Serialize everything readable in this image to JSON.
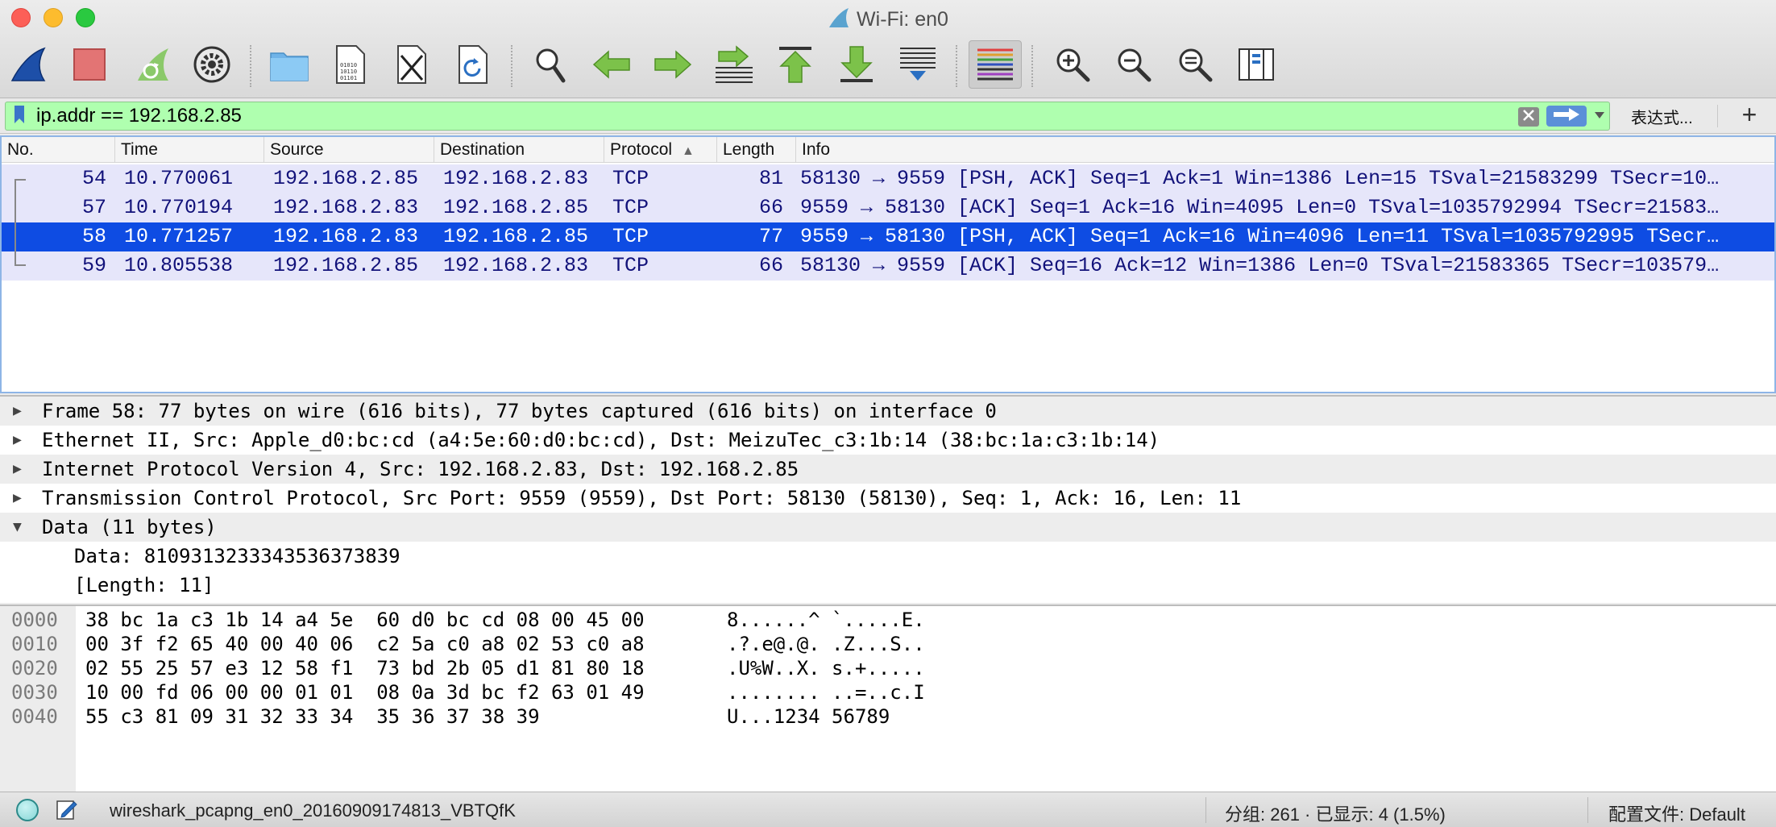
{
  "window": {
    "title": "Wi-Fi: en0"
  },
  "toolbar": {
    "buttons": [
      {
        "name": "start-capture-icon"
      },
      {
        "name": "stop-capture-icon"
      },
      {
        "name": "restart-capture-icon"
      },
      {
        "name": "capture-options-icon"
      },
      {
        "name": "open-file-icon"
      },
      {
        "name": "save-file-icon"
      },
      {
        "name": "close-file-icon"
      },
      {
        "name": "reload-file-icon"
      },
      {
        "name": "find-packet-icon"
      },
      {
        "name": "go-back-icon"
      },
      {
        "name": "go-forward-icon"
      },
      {
        "name": "go-to-packet-icon"
      },
      {
        "name": "go-first-packet-icon"
      },
      {
        "name": "go-last-packet-icon"
      },
      {
        "name": "auto-scroll-icon"
      },
      {
        "name": "colorize-icon"
      },
      {
        "name": "zoom-in-icon"
      },
      {
        "name": "zoom-out-icon"
      },
      {
        "name": "normal-size-icon"
      },
      {
        "name": "resize-columns-icon"
      }
    ]
  },
  "filter": {
    "value": "ip.addr == 192.168.2.85",
    "expression_label": "表达式...",
    "add_label": "+"
  },
  "packet_list": {
    "columns": [
      "No.",
      "Time",
      "Source",
      "Destination",
      "Protocol",
      "Length",
      "Info"
    ],
    "rows": [
      {
        "no": "54",
        "time": "10.770061",
        "src": "192.168.2.85",
        "dst": "192.168.2.83",
        "proto": "TCP",
        "len": "81",
        "info": "58130 → 9559 [PSH, ACK] Seq=1 Ack=1 Win=1386 Len=15 TSval=21583299 TSecr=10…"
      },
      {
        "no": "57",
        "time": "10.770194",
        "src": "192.168.2.83",
        "dst": "192.168.2.85",
        "proto": "TCP",
        "len": "66",
        "info": "9559 → 58130 [ACK] Seq=1 Ack=16 Win=4095 Len=0 TSval=1035792994 TSecr=21583…"
      },
      {
        "no": "58",
        "time": "10.771257",
        "src": "192.168.2.83",
        "dst": "192.168.2.85",
        "proto": "TCP",
        "len": "77",
        "info": "9559 → 58130 [PSH, ACK] Seq=1 Ack=16 Win=4096 Len=11 TSval=1035792995 TSecr…"
      },
      {
        "no": "59",
        "time": "10.805538",
        "src": "192.168.2.85",
        "dst": "192.168.2.83",
        "proto": "TCP",
        "len": "66",
        "info": "58130 → 9559 [ACK] Seq=16 Ack=12 Win=1386 Len=0 TSval=21583365 TSecr=103579…"
      }
    ],
    "selected_index": 2
  },
  "details": {
    "tree": [
      {
        "expanded": false,
        "text": "Frame 58: 77 bytes on wire (616 bits), 77 bytes captured (616 bits) on interface 0"
      },
      {
        "expanded": false,
        "text": "Ethernet II, Src: Apple_d0:bc:cd (a4:5e:60:d0:bc:cd), Dst: MeizuTec_c3:1b:14 (38:bc:1a:c3:1b:14)"
      },
      {
        "expanded": false,
        "text": "Internet Protocol Version 4, Src: 192.168.2.83, Dst: 192.168.2.85"
      },
      {
        "expanded": false,
        "text": "Transmission Control Protocol, Src Port: 9559 (9559), Dst Port: 58130 (58130), Seq: 1, Ack: 16, Len: 11"
      },
      {
        "expanded": true,
        "text": "Data (11 bytes)"
      }
    ],
    "data_children": [
      "Data: 8109313233343536373839",
      "[Length: 11]"
    ]
  },
  "bytes": {
    "rows": [
      {
        "offset": "0000",
        "hex": "38 bc 1a c3 1b 14 a4 5e  60 d0 bc cd 08 00 45 00",
        "ascii": "8......^ `.....E."
      },
      {
        "offset": "0010",
        "hex": "00 3f f2 65 40 00 40 06  c2 5a c0 a8 02 53 c0 a8",
        "ascii": ".?.e@.@. .Z...S.."
      },
      {
        "offset": "0020",
        "hex": "02 55 25 57 e3 12 58 f1  73 bd 2b 05 d1 81 80 18",
        "ascii": ".U%W..X. s.+....."
      },
      {
        "offset": "0030",
        "hex": "10 00 fd 06 00 00 01 01  08 0a 3d bc f2 63 01 49",
        "ascii": "........ ..=..c.I"
      },
      {
        "offset": "0040",
        "hex": "55 c3 81 09 31 32 33 34  35 36 37 38 39",
        "ascii": "U...1234 56789"
      }
    ]
  },
  "status": {
    "file": "wireshark_pcapng_en0_20160909174813_VBTQfK",
    "packets": "分组: 261 · 已显示: 4 (1.5%)",
    "profile": "配置文件: Default"
  }
}
